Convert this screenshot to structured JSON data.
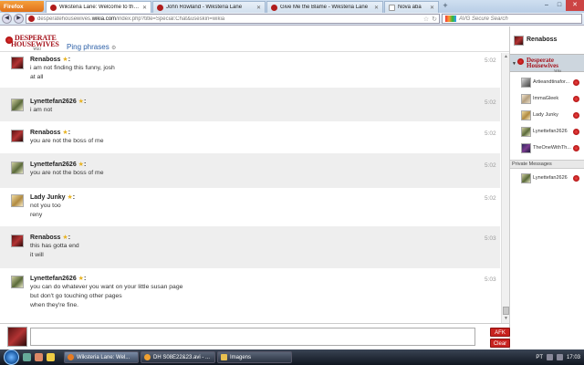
{
  "browser": {
    "menu_label": "Firefox",
    "tabs": [
      {
        "label": "Wiksteria Lane: Welcome to the Wikst...",
        "active": true
      },
      {
        "label": "John Rowland - Wiksteria Lane",
        "active": false
      },
      {
        "label": "Give Me the Blame - Wiksteria Lane",
        "active": false
      },
      {
        "label": "Nova aba",
        "active": false
      }
    ],
    "new_tab": "+",
    "url_host": "desperatehousewives.",
    "url_domain": "wikia.com",
    "url_path": "/index.php?title=Special:Chat&useskin=wikia",
    "search_placeholder": "AVG Secure Search"
  },
  "chat": {
    "logo_line1": "DESPERATE",
    "logo_line2": "HOUSEWIVES",
    "logo_line3": "Wiki",
    "ping_label": "Ping phrases",
    "messages": [
      {
        "user": "Renaboss",
        "avatar": "rena",
        "lines": [
          "i am not finding this funny, josh",
          "at all"
        ],
        "time": "5:02"
      },
      {
        "user": "Lynettefan2626",
        "avatar": "lynette",
        "lines": [
          "i am not"
        ],
        "time": "5:02"
      },
      {
        "user": "Renaboss",
        "avatar": "rena",
        "lines": [
          "you are not the boss of me"
        ],
        "time": "5:02"
      },
      {
        "user": "Lynettefan2626",
        "avatar": "lynette",
        "lines": [
          "you are not the boss of me"
        ],
        "time": "5:02"
      },
      {
        "user": "Lady Junky",
        "avatar": "lady",
        "lines": [
          "not you too",
          "reny"
        ],
        "time": "5:02"
      },
      {
        "user": "Renaboss",
        "avatar": "rena",
        "lines": [
          "this has gotta end",
          "it will"
        ],
        "time": "5:03"
      },
      {
        "user": "Lynettefan2626",
        "avatar": "lynette",
        "lines": [
          "you can do whatever you want on your little susan page",
          "but don't go touching other pages",
          "when they're fine."
        ],
        "time": "5:03"
      }
    ],
    "input_value": "",
    "afk_label": "AFK",
    "clear_label": "Clear"
  },
  "sidebar": {
    "self_name": "Renaboss",
    "room_logo_line1": "Desperate Housewives",
    "room_logo_line2": "Wiki",
    "users": [
      {
        "name": "Artieandtinafor...",
        "avatar": "artie"
      },
      {
        "name": "ImmaGleek",
        "avatar": "imma"
      },
      {
        "name": "Lady Junky",
        "avatar": "lady"
      },
      {
        "name": "Lynettefan2626",
        "avatar": "lynette"
      },
      {
        "name": "TheOneWithTh...",
        "avatar": "onewith"
      }
    ],
    "private_header": "Private Messages",
    "private_users": [
      {
        "name": "Lynettefan2626",
        "avatar": "lynette"
      }
    ]
  },
  "taskbar": {
    "tasks": [
      {
        "label": "Wiksteria Lane: Wel...",
        "active": true
      },
      {
        "label": "DH S08E22&23.avi - ...",
        "active": false
      },
      {
        "label": "Imagens",
        "active": false
      }
    ],
    "lang": "PT",
    "clock": "17:03"
  },
  "colors": {
    "accent_red": "#c8221f",
    "link_blue": "#2b5fa7",
    "shaded_row": "#eeeeee"
  }
}
